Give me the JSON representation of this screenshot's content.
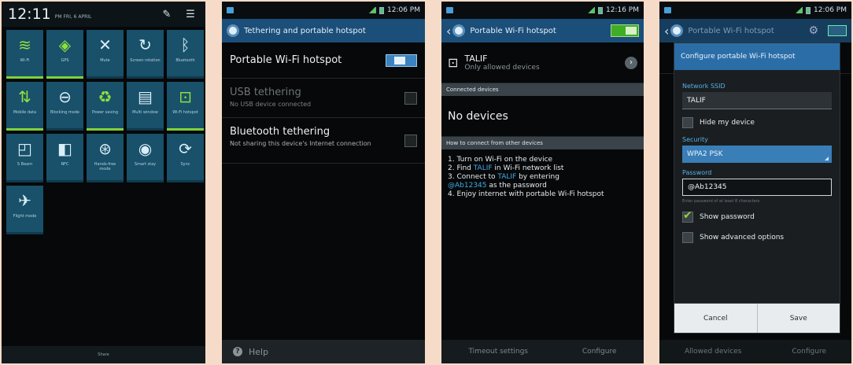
{
  "panel": {
    "time": "12:11",
    "date": "PM FRI, 6 APRIL",
    "footer": "Share",
    "tiles": [
      {
        "label": "Wi-Fi",
        "icon": "wifi-icon",
        "glyph": "≋",
        "on": true
      },
      {
        "label": "GPS",
        "icon": "gps-icon",
        "glyph": "◈",
        "on": true
      },
      {
        "label": "Mute",
        "icon": "mute-icon",
        "glyph": "✕",
        "on": false
      },
      {
        "label": "Screen rotation",
        "icon": "rotation-icon",
        "glyph": "↻",
        "on": false
      },
      {
        "label": "Bluetooth",
        "icon": "bluetooth-icon",
        "glyph": "ᛒ",
        "on": false
      },
      {
        "label": "Mobile data",
        "icon": "mobile-data-icon",
        "glyph": "⇅",
        "on": true
      },
      {
        "label": "Blocking mode",
        "icon": "blocking-icon",
        "glyph": "⊖",
        "on": false
      },
      {
        "label": "Power saving",
        "icon": "power-saving-icon",
        "glyph": "♻",
        "on": true
      },
      {
        "label": "Multi window",
        "icon": "multi-window-icon",
        "glyph": "▤",
        "on": false
      },
      {
        "label": "Wi-Fi hotspot",
        "icon": "hotspot-icon",
        "glyph": "⊡",
        "on": true
      },
      {
        "label": "S Beam",
        "icon": "s-beam-icon",
        "glyph": "◰",
        "on": false
      },
      {
        "label": "NFC",
        "icon": "nfc-icon",
        "glyph": "◧",
        "on": false
      },
      {
        "label": "Hands-free mode",
        "icon": "hands-free-icon",
        "glyph": "⊛",
        "on": false
      },
      {
        "label": "Smart stay",
        "icon": "smart-stay-icon",
        "glyph": "◉",
        "on": false
      },
      {
        "label": "Sync",
        "icon": "sync-icon",
        "glyph": "⟳",
        "on": false
      },
      {
        "label": "Flight mode",
        "icon": "flight-mode-icon",
        "glyph": "✈",
        "on": false
      }
    ]
  },
  "tethering": {
    "title": "Tethering and portable hotspot",
    "hotspot": "Portable Wi-Fi hotspot",
    "usb_title": "USB tethering",
    "usb_sub": "No USB device connected",
    "bt_title": "Bluetooth tethering",
    "bt_sub": "Not sharing this device's Internet connection",
    "help": "Help"
  },
  "hotspot": {
    "title": "Portable Wi-Fi hotspot",
    "network_name": "TALIF",
    "network_sub": "Only allowed devices",
    "connected_header": "Connected devices",
    "no_devices": "No devices",
    "howto_header": "How to connect from other devices",
    "steps": {
      "s1": "1. Turn on Wi-Fi on the device",
      "s2a": "2. Find ",
      "s2b": "TALIF",
      "s2c": " in Wi-Fi network list",
      "s3a": "3. Connect to ",
      "s3b": "TALIF",
      "s3c": " by entering",
      "s3d": "@Ab12345",
      "s3e": " as the password",
      "s4": "4. Enjoy internet with portable Wi-Fi hotspot"
    },
    "footer_left": "Timeout settings",
    "footer_right": "Configure"
  },
  "configure": {
    "bg_title": "Portable Wi-Fi hotspot",
    "dialog_title": "Configure portable Wi-Fi hotspot",
    "ssid_label": "Network SSID",
    "ssid_value": "TALIF",
    "hide_label": "Hide my device",
    "security_label": "Security",
    "security_value": "WPA2 PSK",
    "password_label": "Password",
    "password_value": "@Ab12345",
    "hint": "Enter password of at least 8 characters",
    "show_password": "Show password",
    "show_advanced": "Show advanced options",
    "cancel": "Cancel",
    "save": "Save",
    "footer_left": "Allowed devices",
    "footer_right": "Configure"
  },
  "status": {
    "time2": "12:06 PM",
    "time3": "12:16 PM",
    "time4": "12:06 PM"
  }
}
